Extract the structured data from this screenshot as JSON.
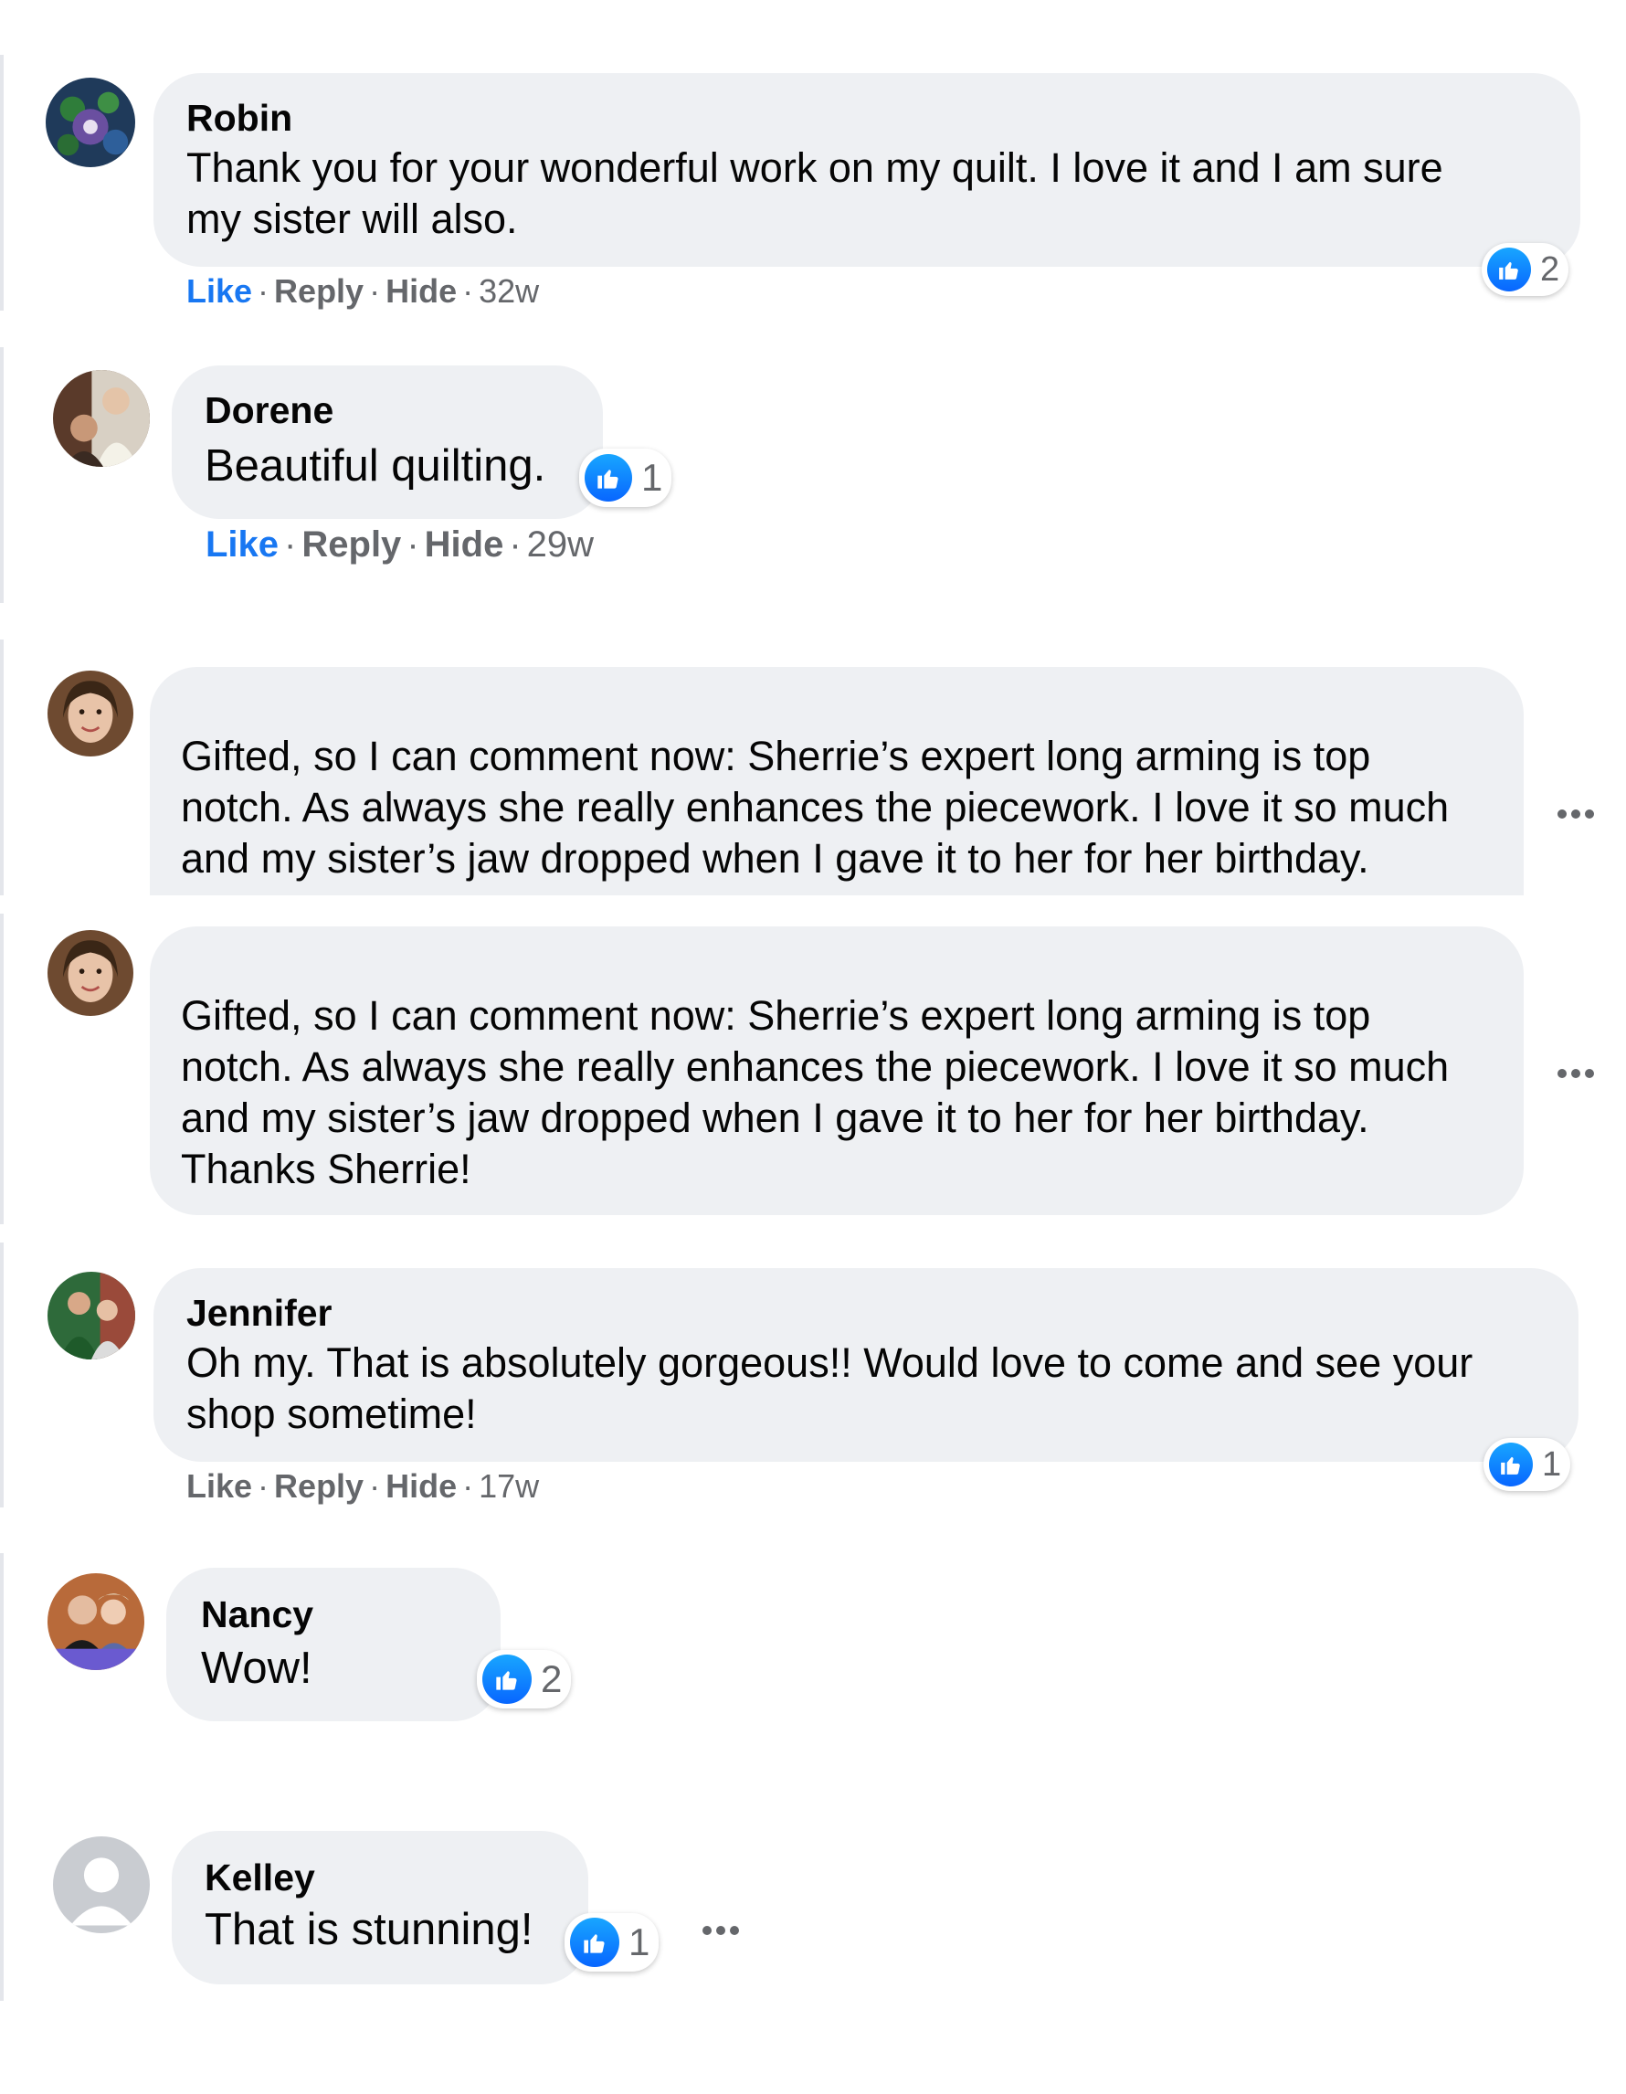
{
  "actions": {
    "like": "Like",
    "reply": "Reply",
    "hide": "Hide",
    "sep": "·"
  },
  "comments": [
    {
      "name": "Robin",
      "line1": "Thank you for your wonderful work on my quilt. I love it and I am sure",
      "line2": "my sister will also.",
      "time": "32w",
      "reactions": "2",
      "liked": true
    },
    {
      "name": "Dorene",
      "text": "Beautiful quilting.",
      "time": "29w",
      "reactions": "1",
      "liked": true
    },
    {
      "name": "",
      "line1": "Gifted, so I can comment now: Sherrie’s expert long arming is top",
      "line2": "notch. As always she really enhances the piecework. I love it so much",
      "line3": "and my sister’s jaw dropped when I gave it to her for her birthday."
    },
    {
      "name": "",
      "line1": "Gifted, so I can comment now: Sherrie’s expert long arming is top",
      "line2": "notch. As always she really enhances the piecework. I love it so much",
      "line3": "and my sister’s jaw dropped when I gave it to her for her birthday.",
      "line4": "Thanks Sherrie!"
    },
    {
      "name": "Jennifer",
      "line1": "Oh my. That is absolutely gorgeous!! Would love to come and see your",
      "line2": "shop sometime!",
      "time": "17w",
      "reactions": "1",
      "liked": false
    },
    {
      "name": "Nancy",
      "text": "Wow!",
      "reactions": "2"
    },
    {
      "name": "Kelley",
      "text": "That is stunning!",
      "reactions": "1"
    }
  ],
  "icons": {
    "like": "thumbs-up-icon",
    "more": "more-horizontal-icon",
    "avatar": "user-avatar"
  },
  "colors": {
    "bubble": "#eef0f3",
    "liked": "#1877f2",
    "meta": "#65676b",
    "like_badge": "#0866ff"
  }
}
